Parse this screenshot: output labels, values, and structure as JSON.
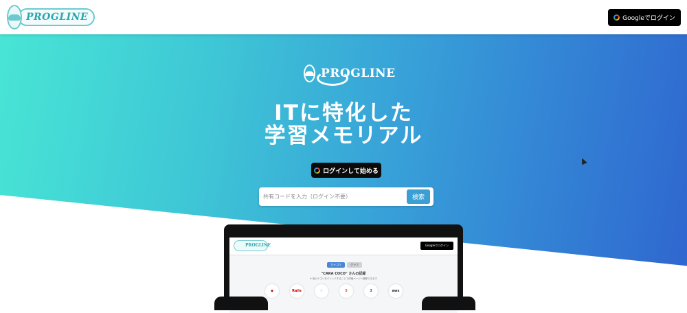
{
  "header": {
    "logo_text": "PROGLINE",
    "login_button": "Googleでログイン"
  },
  "hero": {
    "logo_text": "PROGLINE",
    "headline_line1": "ITに特化した",
    "headline_line2": "学習メモリアル",
    "cta_label": "ログインして始める",
    "search": {
      "placeholder": "共有コードを入力（ログイン不要）",
      "button_label": "検索"
    }
  },
  "mockup": {
    "logo_text": "PROGLINE",
    "login_button": "Googleでログイン",
    "tabs": [
      {
        "label": "カテゴリ",
        "active": true
      },
      {
        "label": "グラフ",
        "active": false
      }
    ],
    "title": "\"CARA COCO\" さんの記録",
    "subtitle": "※ 各カテゴリをクリックすることで詳細ページへ遷移できます",
    "icons": [
      "ruby-icon",
      "rails-icon",
      "react-icon",
      "html5-icon",
      "css3-icon",
      "aws-icon"
    ],
    "icon_labels": [
      "",
      "Rails",
      "",
      "5",
      "3",
      "aws"
    ]
  },
  "colors": {
    "gradient_start": "#48e5d5",
    "gradient_end": "#2f66cf",
    "logo_accent": "#6ec9cf",
    "search_button": "#3b9fd4"
  }
}
